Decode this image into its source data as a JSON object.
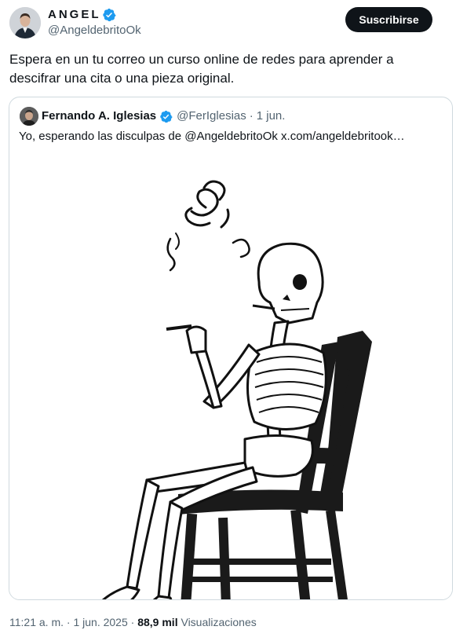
{
  "author": {
    "name": "ANGEL",
    "handle": "@AngeldebritoOk",
    "verified": true
  },
  "subscribe_label": "Suscribirse",
  "tweet_text": "Espera en un tu correo un curso online de redes para aprender a descifrar una cita o una pieza original.",
  "quoted": {
    "name": "Fernando A. Iglesias",
    "handle": "@FerIglesias",
    "separator": "·",
    "date": "1 jun.",
    "text": "Yo, esperando las disculpas de @AngeldebritoOk  x.com/angeldebritook…",
    "image_alt": "skeleton sitting on a wooden chair smoking a cigarette"
  },
  "footer": {
    "time": "11:21 a. m.",
    "date": "1 jun. 2025",
    "views_count": "88,9 mil",
    "views_label": "Visualizaciones"
  },
  "colors": {
    "verified_blue": "#1d9bf0",
    "text_primary": "#0f1419",
    "text_secondary": "#536471",
    "border": "#cfd9de",
    "button_bg": "#0f1419"
  },
  "icons": {
    "verified": "verified-badge-icon"
  }
}
